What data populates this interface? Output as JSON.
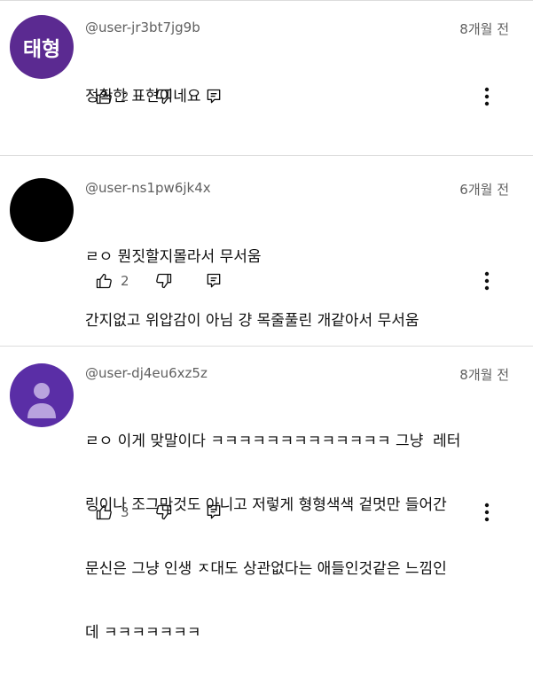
{
  "comments": [
    {
      "avatar_text": "태형",
      "avatar_color": "#5b2a91",
      "handle": "@user-jr3bt7jg9b",
      "time": "8개월 전",
      "lines": [
        "정확한 표현이네요"
      ],
      "likes": "2"
    },
    {
      "avatar_text": "",
      "avatar_color": "#000000",
      "handle": "@user-ns1pw6jk4x",
      "time": "6개월 전",
      "lines": [
        "ㄹㅇ 뭔짓할지몰라서 무서움",
        "간지없고 위압감이 아님 걍 목줄풀린 개같아서 무서움"
      ],
      "likes": "2"
    },
    {
      "avatar_text": "",
      "avatar_color": "#5a2ea6",
      "handle": "@user-dj4eu6xz5z",
      "time": "8개월 전",
      "lines": [
        "ㄹㅇ 이게 맞말이다 ㅋㅋㅋㅋㅋㅋㅋㅋㅋㅋㅋㅋㅋ 그냥  레터",
        "링이나 조그만것도 아니고 저렇게 형형색색 겉멋만 들어간",
        "문신은 그냥 인생 ㅈ대도 상관없다는 애들인것같은 느낌인",
        "데 ㅋㅋㅋㅋㅋㅋㅋ"
      ],
      "likes": "3"
    }
  ]
}
